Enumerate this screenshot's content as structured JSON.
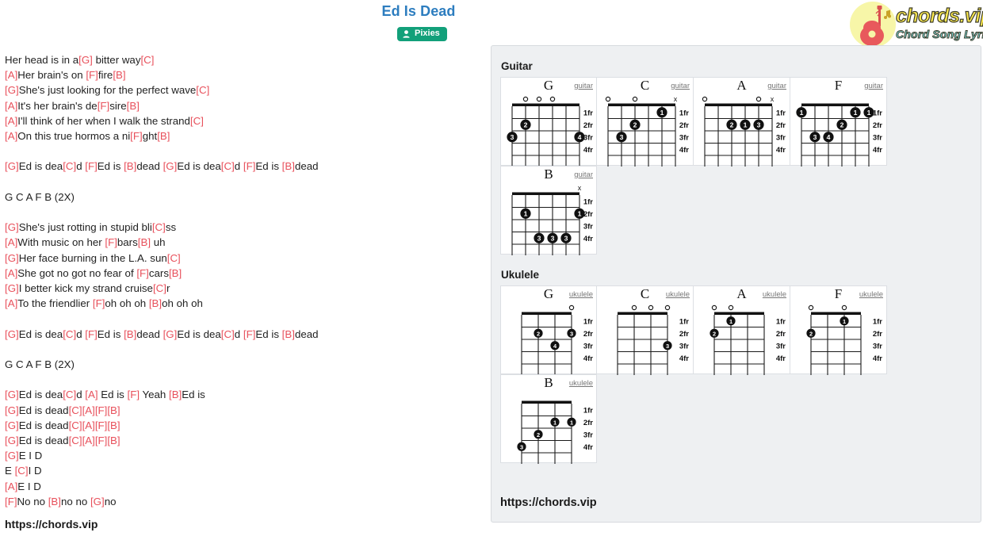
{
  "song": {
    "title": "Ed Is Dead",
    "artist": "Pixies",
    "artist_icon": "person-icon"
  },
  "logo": {
    "icon": "guitar-icon",
    "main": "chords.vip",
    "sub": "Chord Song Lyric"
  },
  "colors": {
    "title": "#2d7dbf",
    "chord": "#e8505b",
    "badge": "#12a07a",
    "panel_bg": "#eef0f2",
    "logo_yellow": "#fce94f",
    "logo_cyan": "#7fe3e8",
    "logo_circle": "#f7f6a8"
  },
  "lyrics": [
    [
      {
        "t": "Her head is in a",
        "c": false
      },
      {
        "t": "[G]",
        "c": true
      },
      {
        "t": " bitter way",
        "c": false
      },
      {
        "t": "[C]",
        "c": true
      }
    ],
    [
      {
        "t": "[A]",
        "c": true
      },
      {
        "t": "Her brain's on ",
        "c": false
      },
      {
        "t": "[F]",
        "c": true
      },
      {
        "t": "fire",
        "c": false
      },
      {
        "t": "[B]",
        "c": true
      }
    ],
    [
      {
        "t": "[G]",
        "c": true
      },
      {
        "t": "She's just looking for the perfect wave",
        "c": false
      },
      {
        "t": "[C]",
        "c": true
      }
    ],
    [
      {
        "t": "[A]",
        "c": true
      },
      {
        "t": "It's her brain's de",
        "c": false
      },
      {
        "t": "[F]",
        "c": true
      },
      {
        "t": "sire",
        "c": false
      },
      {
        "t": "[B]",
        "c": true
      }
    ],
    [
      {
        "t": "[A]",
        "c": true
      },
      {
        "t": "I'll think of her when I walk the strand",
        "c": false
      },
      {
        "t": "[C]",
        "c": true
      }
    ],
    [
      {
        "t": "[A]",
        "c": true
      },
      {
        "t": "On this true hormos a ni",
        "c": false
      },
      {
        "t": "[F]",
        "c": true
      },
      {
        "t": "ght",
        "c": false
      },
      {
        "t": "[B]",
        "c": true
      }
    ],
    [],
    [
      {
        "t": "[G]",
        "c": true
      },
      {
        "t": "Ed is dea",
        "c": false
      },
      {
        "t": "[C]",
        "c": true
      },
      {
        "t": "d ",
        "c": false
      },
      {
        "t": "[F]",
        "c": true
      },
      {
        "t": "Ed is ",
        "c": false
      },
      {
        "t": "[B]",
        "c": true
      },
      {
        "t": "dead ",
        "c": false
      },
      {
        "t": "[G]",
        "c": true
      },
      {
        "t": "Ed is dea",
        "c": false
      },
      {
        "t": "[C]",
        "c": true
      },
      {
        "t": "d ",
        "c": false
      },
      {
        "t": "[F]",
        "c": true
      },
      {
        "t": "Ed is ",
        "c": false
      },
      {
        "t": "[B]",
        "c": true
      },
      {
        "t": "dead",
        "c": false
      }
    ],
    [],
    [
      {
        "t": "G C A F B (2X)",
        "c": false
      }
    ],
    [],
    [
      {
        "t": "[G]",
        "c": true
      },
      {
        "t": "She's just rotting in stupid bli",
        "c": false
      },
      {
        "t": "[C]",
        "c": true
      },
      {
        "t": "ss",
        "c": false
      }
    ],
    [
      {
        "t": "[A]",
        "c": true
      },
      {
        "t": "With music on her ",
        "c": false
      },
      {
        "t": "[F]",
        "c": true
      },
      {
        "t": "bars",
        "c": false
      },
      {
        "t": "[B]",
        "c": true
      },
      {
        "t": " uh",
        "c": false
      }
    ],
    [
      {
        "t": "[G]",
        "c": true
      },
      {
        "t": "Her face burning in the L.A. sun",
        "c": false
      },
      {
        "t": "[C]",
        "c": true
      }
    ],
    [
      {
        "t": "[A]",
        "c": true
      },
      {
        "t": "She got no got no fear of ",
        "c": false
      },
      {
        "t": "[F]",
        "c": true
      },
      {
        "t": "cars",
        "c": false
      },
      {
        "t": "[B]",
        "c": true
      }
    ],
    [
      {
        "t": "[G]",
        "c": true
      },
      {
        "t": "I better kick my strand cruise",
        "c": false
      },
      {
        "t": "[C]",
        "c": true
      },
      {
        "t": "r",
        "c": false
      }
    ],
    [
      {
        "t": "[A]",
        "c": true
      },
      {
        "t": "To the friendlier ",
        "c": false
      },
      {
        "t": "[F]",
        "c": true
      },
      {
        "t": "oh oh oh ",
        "c": false
      },
      {
        "t": "[B]",
        "c": true
      },
      {
        "t": "oh oh oh",
        "c": false
      }
    ],
    [],
    [
      {
        "t": "[G]",
        "c": true
      },
      {
        "t": "Ed is dea",
        "c": false
      },
      {
        "t": "[C]",
        "c": true
      },
      {
        "t": "d ",
        "c": false
      },
      {
        "t": "[F]",
        "c": true
      },
      {
        "t": "Ed is ",
        "c": false
      },
      {
        "t": "[B]",
        "c": true
      },
      {
        "t": "dead ",
        "c": false
      },
      {
        "t": "[G]",
        "c": true
      },
      {
        "t": "Ed is dea",
        "c": false
      },
      {
        "t": "[C]",
        "c": true
      },
      {
        "t": "d ",
        "c": false
      },
      {
        "t": "[F]",
        "c": true
      },
      {
        "t": "Ed is ",
        "c": false
      },
      {
        "t": "[B]",
        "c": true
      },
      {
        "t": "dead",
        "c": false
      }
    ],
    [],
    [
      {
        "t": "G C A F B (2X)",
        "c": false
      }
    ],
    [],
    [
      {
        "t": "[G]",
        "c": true
      },
      {
        "t": "Ed is dea",
        "c": false
      },
      {
        "t": "[C]",
        "c": true
      },
      {
        "t": "d ",
        "c": false
      },
      {
        "t": "[A]",
        "c": true
      },
      {
        "t": " Ed is ",
        "c": false
      },
      {
        "t": "[F]",
        "c": true
      },
      {
        "t": " Yeah ",
        "c": false
      },
      {
        "t": "[B]",
        "c": true
      },
      {
        "t": "Ed is",
        "c": false
      }
    ],
    [
      {
        "t": "[G]",
        "c": true
      },
      {
        "t": "Ed is dead",
        "c": false
      },
      {
        "t": "[C][A][F][B]",
        "c": true
      }
    ],
    [
      {
        "t": "[G]",
        "c": true
      },
      {
        "t": "Ed is dead",
        "c": false
      },
      {
        "t": "[C][A][F][B]",
        "c": true
      }
    ],
    [
      {
        "t": "[G]",
        "c": true
      },
      {
        "t": "Ed is dead",
        "c": false
      },
      {
        "t": "[C][A][F][B]",
        "c": true
      }
    ],
    [
      {
        "t": "[G]",
        "c": true
      },
      {
        "t": "E I D",
        "c": false
      }
    ],
    [
      {
        "t": "E ",
        "c": false
      },
      {
        "t": "[C]",
        "c": true
      },
      {
        "t": "I D",
        "c": false
      }
    ],
    [
      {
        "t": "[A]",
        "c": true
      },
      {
        "t": "E I D",
        "c": false
      }
    ],
    [
      {
        "t": "[F]",
        "c": true
      },
      {
        "t": "No no ",
        "c": false
      },
      {
        "t": "[B]",
        "c": true
      },
      {
        "t": "no no ",
        "c": false
      },
      {
        "t": "[G]",
        "c": true
      },
      {
        "t": "no",
        "c": false
      }
    ]
  ],
  "lyrics_footer": "https://chords.vip",
  "panel": {
    "footer": "https://chords.vip",
    "fret_labels": [
      "1fr",
      "2fr",
      "3fr",
      "4fr"
    ],
    "sections": [
      {
        "title": "Guitar",
        "instrument_label": "guitar",
        "strings": 6,
        "chords": [
          {
            "name": "G",
            "top": [
              "",
              "o",
              "o",
              "o",
              "",
              ""
            ],
            "dots": [
              {
                "string": 5,
                "fret": 2,
                "finger": "2"
              },
              {
                "string": 6,
                "fret": 3,
                "finger": "3"
              },
              {
                "string": 1,
                "fret": 3,
                "finger": "4"
              }
            ]
          },
          {
            "name": "C",
            "top": [
              "o",
              "",
              "o",
              "",
              "",
              "x"
            ],
            "dots": [
              {
                "string": 2,
                "fret": 1,
                "finger": "1"
              },
              {
                "string": 4,
                "fret": 2,
                "finger": "2"
              },
              {
                "string": 5,
                "fret": 3,
                "finger": "3"
              }
            ]
          },
          {
            "name": "A",
            "top": [
              "o",
              "",
              "",
              "",
              "o",
              "x"
            ],
            "dots": [
              {
                "string": 4,
                "fret": 2,
                "finger": "2"
              },
              {
                "string": 3,
                "fret": 2,
                "finger": "1"
              },
              {
                "string": 2,
                "fret": 2,
                "finger": "3"
              }
            ]
          },
          {
            "name": "F",
            "top": [
              "",
              "",
              "",
              "",
              "",
              ""
            ],
            "dots": [
              {
                "string": 6,
                "fret": 1,
                "finger": "1"
              },
              {
                "string": 2,
                "fret": 1,
                "finger": "1"
              },
              {
                "string": 1,
                "fret": 1,
                "finger": "1"
              },
              {
                "string": 3,
                "fret": 2,
                "finger": "2"
              },
              {
                "string": 5,
                "fret": 3,
                "finger": "3"
              },
              {
                "string": 4,
                "fret": 3,
                "finger": "4"
              }
            ]
          },
          {
            "name": "B",
            "top": [
              "",
              "",
              "",
              "",
              "",
              "x"
            ],
            "dots": [
              {
                "string": 5,
                "fret": 2,
                "finger": "1"
              },
              {
                "string": 1,
                "fret": 2,
                "finger": "1"
              },
              {
                "string": 4,
                "fret": 4,
                "finger": "3"
              },
              {
                "string": 3,
                "fret": 4,
                "finger": "3"
              },
              {
                "string": 2,
                "fret": 4,
                "finger": "3"
              }
            ]
          }
        ]
      },
      {
        "title": "Ukulele",
        "instrument_label": "ukulele",
        "strings": 4,
        "chords": [
          {
            "name": "G",
            "top": [
              "",
              "",
              "",
              "o"
            ],
            "dots": [
              {
                "string": 3,
                "fret": 2,
                "finger": "2"
              },
              {
                "string": 1,
                "fret": 2,
                "finger": "3"
              },
              {
                "string": 2,
                "fret": 3,
                "finger": "4"
              }
            ]
          },
          {
            "name": "C",
            "top": [
              "",
              "o",
              "o",
              "o"
            ],
            "dots": [
              {
                "string": 1,
                "fret": 3,
                "finger": "3"
              }
            ]
          },
          {
            "name": "A",
            "top": [
              "o",
              "o",
              "",
              ""
            ],
            "dots": [
              {
                "string": 3,
                "fret": 1,
                "finger": "1"
              },
              {
                "string": 4,
                "fret": 2,
                "finger": "2"
              }
            ]
          },
          {
            "name": "F",
            "top": [
              "o",
              "",
              "o",
              ""
            ],
            "dots": [
              {
                "string": 2,
                "fret": 1,
                "finger": "1"
              },
              {
                "string": 4,
                "fret": 2,
                "finger": "2"
              }
            ]
          },
          {
            "name": "B",
            "top": [
              "",
              "",
              "",
              ""
            ],
            "dots": [
              {
                "string": 2,
                "fret": 2,
                "finger": "1"
              },
              {
                "string": 1,
                "fret": 2,
                "finger": "1"
              },
              {
                "string": 3,
                "fret": 3,
                "finger": "2"
              },
              {
                "string": 4,
                "fret": 4,
                "finger": "3"
              }
            ]
          }
        ]
      }
    ]
  }
}
